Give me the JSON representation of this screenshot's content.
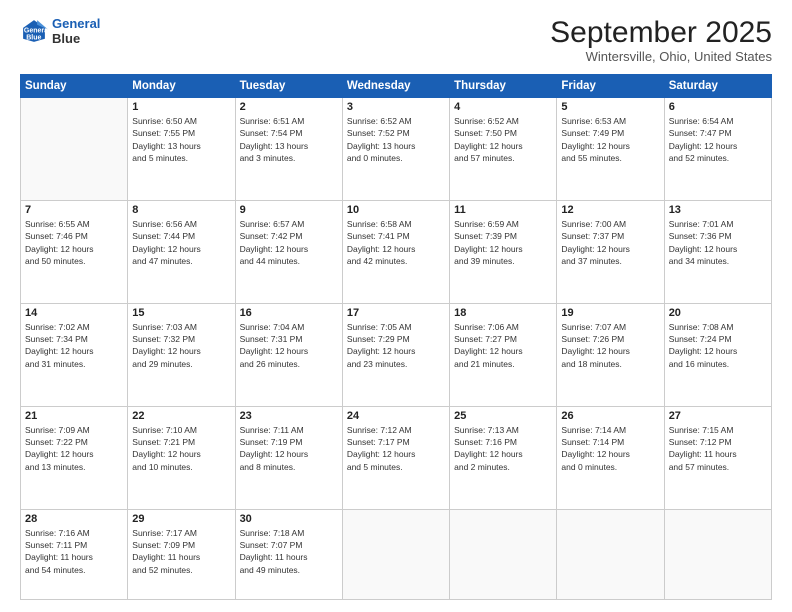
{
  "logo": {
    "line1": "General",
    "line2": "Blue"
  },
  "title": "September 2025",
  "location": "Wintersville, Ohio, United States",
  "days_of_week": [
    "Sunday",
    "Monday",
    "Tuesday",
    "Wednesday",
    "Thursday",
    "Friday",
    "Saturday"
  ],
  "weeks": [
    [
      {
        "day": "",
        "info": ""
      },
      {
        "day": "1",
        "info": "Sunrise: 6:50 AM\nSunset: 7:55 PM\nDaylight: 13 hours\nand 5 minutes."
      },
      {
        "day": "2",
        "info": "Sunrise: 6:51 AM\nSunset: 7:54 PM\nDaylight: 13 hours\nand 3 minutes."
      },
      {
        "day": "3",
        "info": "Sunrise: 6:52 AM\nSunset: 7:52 PM\nDaylight: 13 hours\nand 0 minutes."
      },
      {
        "day": "4",
        "info": "Sunrise: 6:52 AM\nSunset: 7:50 PM\nDaylight: 12 hours\nand 57 minutes."
      },
      {
        "day": "5",
        "info": "Sunrise: 6:53 AM\nSunset: 7:49 PM\nDaylight: 12 hours\nand 55 minutes."
      },
      {
        "day": "6",
        "info": "Sunrise: 6:54 AM\nSunset: 7:47 PM\nDaylight: 12 hours\nand 52 minutes."
      }
    ],
    [
      {
        "day": "7",
        "info": "Sunrise: 6:55 AM\nSunset: 7:46 PM\nDaylight: 12 hours\nand 50 minutes."
      },
      {
        "day": "8",
        "info": "Sunrise: 6:56 AM\nSunset: 7:44 PM\nDaylight: 12 hours\nand 47 minutes."
      },
      {
        "day": "9",
        "info": "Sunrise: 6:57 AM\nSunset: 7:42 PM\nDaylight: 12 hours\nand 44 minutes."
      },
      {
        "day": "10",
        "info": "Sunrise: 6:58 AM\nSunset: 7:41 PM\nDaylight: 12 hours\nand 42 minutes."
      },
      {
        "day": "11",
        "info": "Sunrise: 6:59 AM\nSunset: 7:39 PM\nDaylight: 12 hours\nand 39 minutes."
      },
      {
        "day": "12",
        "info": "Sunrise: 7:00 AM\nSunset: 7:37 PM\nDaylight: 12 hours\nand 37 minutes."
      },
      {
        "day": "13",
        "info": "Sunrise: 7:01 AM\nSunset: 7:36 PM\nDaylight: 12 hours\nand 34 minutes."
      }
    ],
    [
      {
        "day": "14",
        "info": "Sunrise: 7:02 AM\nSunset: 7:34 PM\nDaylight: 12 hours\nand 31 minutes."
      },
      {
        "day": "15",
        "info": "Sunrise: 7:03 AM\nSunset: 7:32 PM\nDaylight: 12 hours\nand 29 minutes."
      },
      {
        "day": "16",
        "info": "Sunrise: 7:04 AM\nSunset: 7:31 PM\nDaylight: 12 hours\nand 26 minutes."
      },
      {
        "day": "17",
        "info": "Sunrise: 7:05 AM\nSunset: 7:29 PM\nDaylight: 12 hours\nand 23 minutes."
      },
      {
        "day": "18",
        "info": "Sunrise: 7:06 AM\nSunset: 7:27 PM\nDaylight: 12 hours\nand 21 minutes."
      },
      {
        "day": "19",
        "info": "Sunrise: 7:07 AM\nSunset: 7:26 PM\nDaylight: 12 hours\nand 18 minutes."
      },
      {
        "day": "20",
        "info": "Sunrise: 7:08 AM\nSunset: 7:24 PM\nDaylight: 12 hours\nand 16 minutes."
      }
    ],
    [
      {
        "day": "21",
        "info": "Sunrise: 7:09 AM\nSunset: 7:22 PM\nDaylight: 12 hours\nand 13 minutes."
      },
      {
        "day": "22",
        "info": "Sunrise: 7:10 AM\nSunset: 7:21 PM\nDaylight: 12 hours\nand 10 minutes."
      },
      {
        "day": "23",
        "info": "Sunrise: 7:11 AM\nSunset: 7:19 PM\nDaylight: 12 hours\nand 8 minutes."
      },
      {
        "day": "24",
        "info": "Sunrise: 7:12 AM\nSunset: 7:17 PM\nDaylight: 12 hours\nand 5 minutes."
      },
      {
        "day": "25",
        "info": "Sunrise: 7:13 AM\nSunset: 7:16 PM\nDaylight: 12 hours\nand 2 minutes."
      },
      {
        "day": "26",
        "info": "Sunrise: 7:14 AM\nSunset: 7:14 PM\nDaylight: 12 hours\nand 0 minutes."
      },
      {
        "day": "27",
        "info": "Sunrise: 7:15 AM\nSunset: 7:12 PM\nDaylight: 11 hours\nand 57 minutes."
      }
    ],
    [
      {
        "day": "28",
        "info": "Sunrise: 7:16 AM\nSunset: 7:11 PM\nDaylight: 11 hours\nand 54 minutes."
      },
      {
        "day": "29",
        "info": "Sunrise: 7:17 AM\nSunset: 7:09 PM\nDaylight: 11 hours\nand 52 minutes."
      },
      {
        "day": "30",
        "info": "Sunrise: 7:18 AM\nSunset: 7:07 PM\nDaylight: 11 hours\nand 49 minutes."
      },
      {
        "day": "",
        "info": ""
      },
      {
        "day": "",
        "info": ""
      },
      {
        "day": "",
        "info": ""
      },
      {
        "day": "",
        "info": ""
      }
    ]
  ]
}
